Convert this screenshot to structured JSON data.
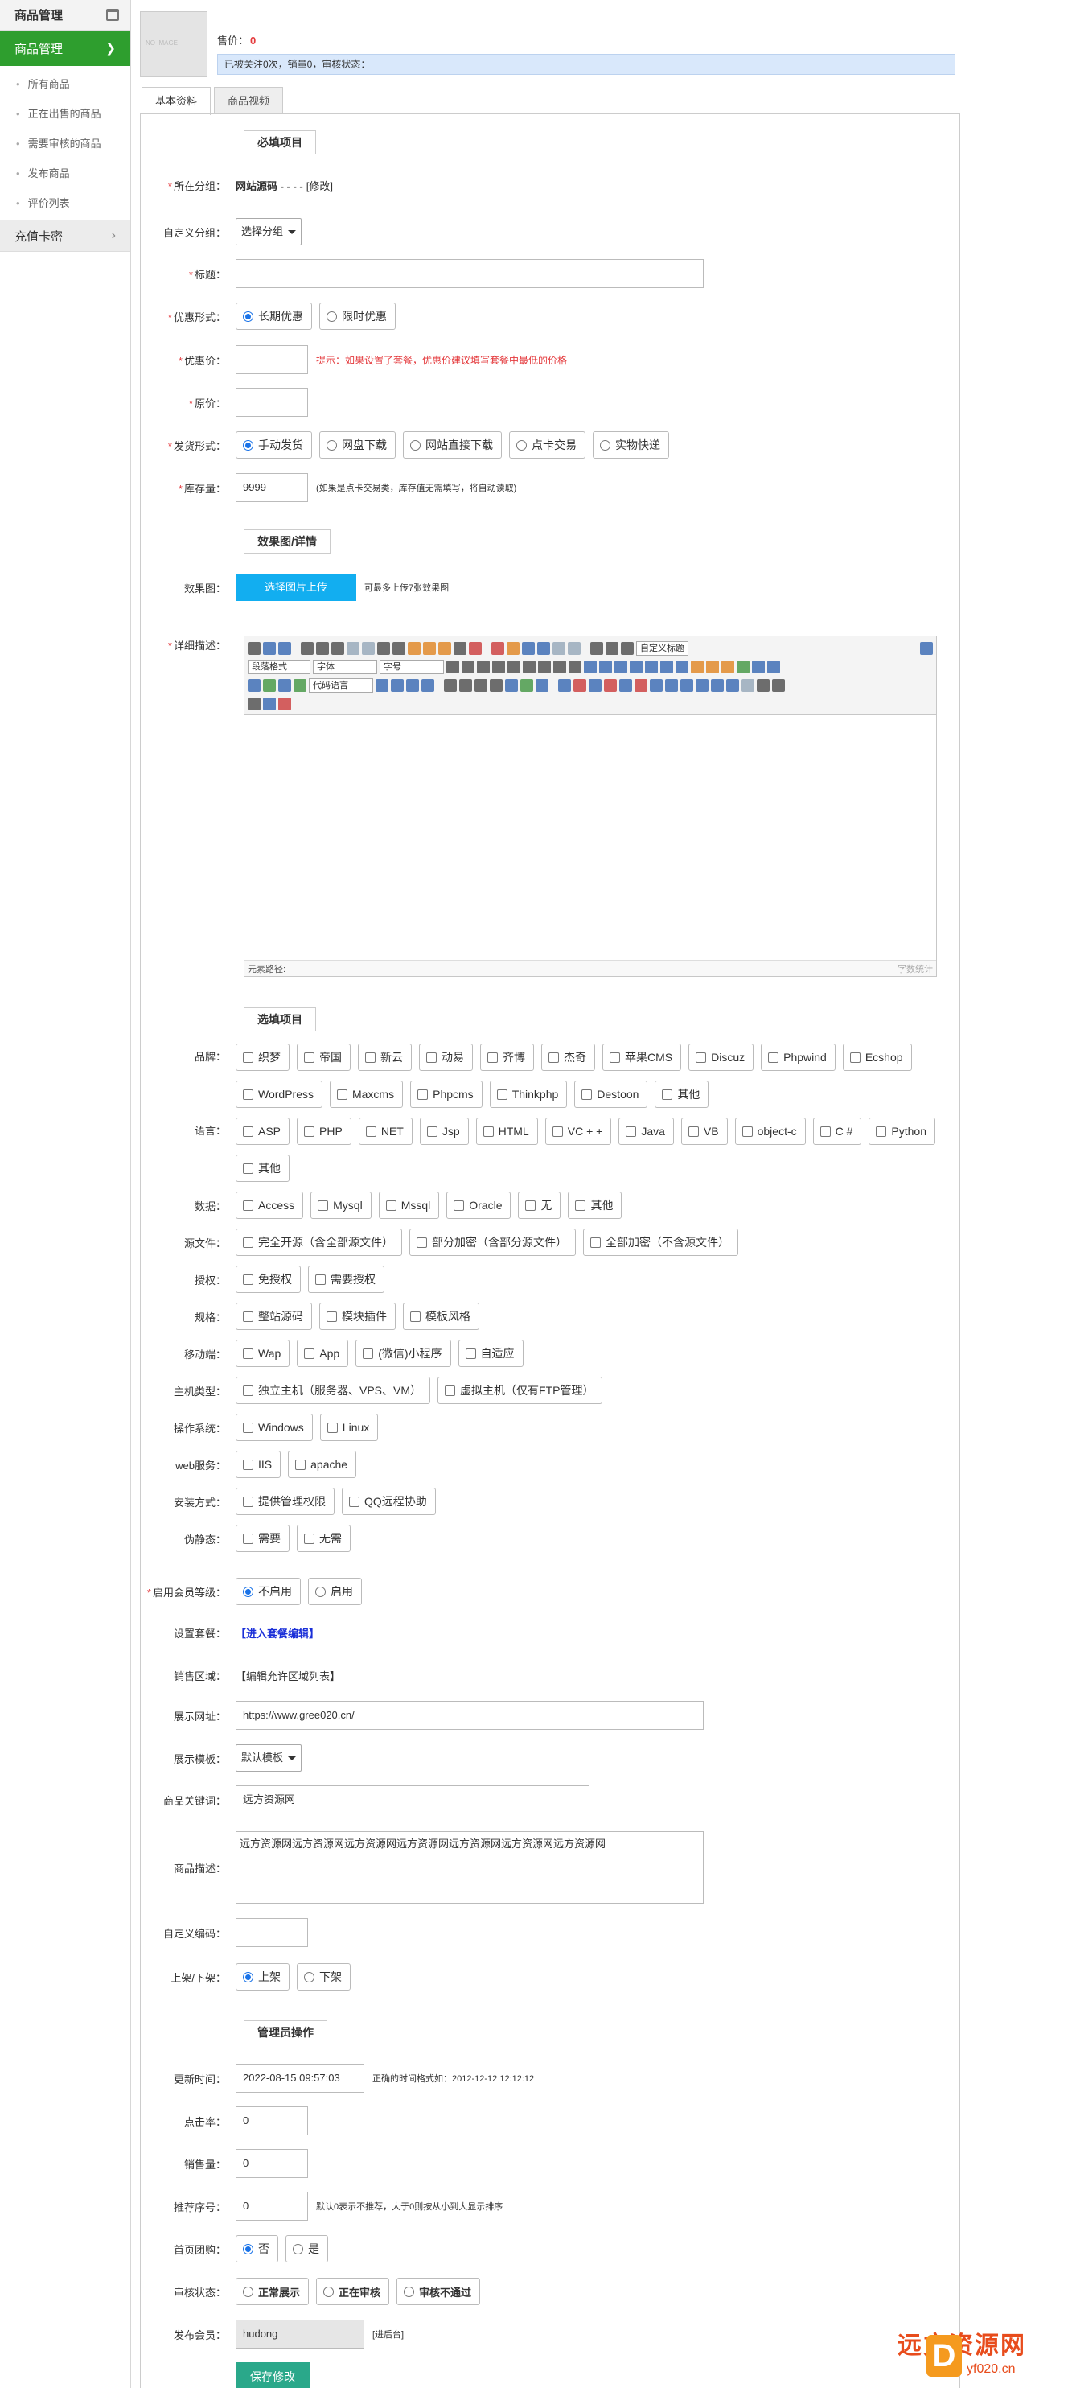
{
  "sidebar": {
    "title": "商品管理",
    "active": "商品管理",
    "items": [
      "所有商品",
      "正在出售的商品",
      "需要审核的商品",
      "发布商品",
      "评价列表"
    ],
    "group": "充值卡密"
  },
  "product": {
    "thumb_text": "NO IMAGE",
    "price_label": "售价：",
    "price_value": "0",
    "info": "已被关注0次，销量0，审核状态："
  },
  "tabs": [
    "基本资料",
    "商品视频"
  ],
  "sections": {
    "required": "必填项目",
    "images": "效果图/详情",
    "options": "选填项目",
    "admin": "管理员操作"
  },
  "form": {
    "category": {
      "label": "所在分组：",
      "value": "网站源码 - - - -",
      "edit": "[修改]"
    },
    "custom_group": {
      "label": "自定义分组：",
      "value": "选择分组"
    },
    "title": {
      "label": "标题：",
      "value": ""
    },
    "discount_type": {
      "label": "优惠形式：",
      "options": [
        "长期优惠",
        "限时优惠"
      ],
      "selected": 0
    },
    "discount_price": {
      "label": "优惠价：",
      "value": "",
      "hint": "提示：如果设置了套餐，优惠价建议填写套餐中最低的价格"
    },
    "original_price": {
      "label": "原价：",
      "value": ""
    },
    "delivery": {
      "label": "发货形式：",
      "options": [
        "手动发货",
        "网盘下载",
        "网站直接下载",
        "点卡交易",
        "实物快递"
      ],
      "selected": 0
    },
    "stock": {
      "label": "库存量：",
      "value": "9999",
      "hint": "(如果是点卡交易类，库存值无需填写，将自动读取)"
    },
    "effect_img": {
      "label": "效果图：",
      "button": "选择图片上传",
      "hint": "可最多上传7张效果图"
    },
    "detail": {
      "label": "详细描述：",
      "paragraph": "段落格式",
      "font": "字体",
      "size": "字号",
      "code": "代码语言",
      "custom_title": "自定义标题",
      "path": "元素路径:",
      "count": "字数统计"
    },
    "brand": {
      "label": "品牌：",
      "options": [
        "织梦",
        "帝国",
        "新云",
        "动易",
        "齐博",
        "杰奇",
        "苹果CMS",
        "Discuz",
        "Phpwind",
        "Ecshop",
        "WordPress",
        "Maxcms",
        "Phpcms",
        "Thinkphp",
        "Destoon",
        "其他"
      ]
    },
    "language": {
      "label": "语言：",
      "options": [
        "ASP",
        "PHP",
        "NET",
        "Jsp",
        "HTML",
        "VC + +",
        "Java",
        "VB",
        "object-c",
        "C #",
        "Python",
        "其他"
      ]
    },
    "database": {
      "label": "数据：",
      "options": [
        "Access",
        "Mysql",
        "Mssql",
        "Oracle",
        "无",
        "其他"
      ]
    },
    "source": {
      "label": "源文件：",
      "options": [
        "完全开源（含全部源文件）",
        "部分加密（含部分源文件）",
        "全部加密（不含源文件）"
      ]
    },
    "license": {
      "label": "授权：",
      "options": [
        "免授权",
        "需要授权"
      ]
    },
    "spec": {
      "label": "规格：",
      "options": [
        "整站源码",
        "模块插件",
        "模板风格"
      ]
    },
    "mobile": {
      "label": "移动端：",
      "options": [
        "Wap",
        "App",
        "(微信)小程序",
        "自适应"
      ]
    },
    "host": {
      "label": "主机类型：",
      "options": [
        "独立主机（服务器、VPS、VM）",
        "虚拟主机（仅有FTP管理）"
      ]
    },
    "os": {
      "label": "操作系统：",
      "options": [
        "Windows",
        "Linux"
      ]
    },
    "web": {
      "label": "web服务：",
      "options": [
        "IIS",
        "apache"
      ]
    },
    "install": {
      "label": "安装方式：",
      "options": [
        "提供管理权限",
        "QQ远程协助"
      ]
    },
    "rewrite": {
      "label": "伪静态：",
      "options": [
        "需要",
        "无需"
      ]
    },
    "member": {
      "label": "启用会员等级：",
      "options": [
        "不启用",
        "启用"
      ],
      "selected": 0
    },
    "package": {
      "label": "设置套餐：",
      "value": "【进入套餐编辑】"
    },
    "region": {
      "label": "销售区域：",
      "value": "【编辑允许区域列表】"
    },
    "demo_url": {
      "label": "展示网址：",
      "value": "https://www.gree020.cn/"
    },
    "template": {
      "label": "展示模板：",
      "value": "默认模板"
    },
    "keywords": {
      "label": "商品关键词：",
      "value": "远方资源网"
    },
    "description": {
      "label": "商品描述：",
      "value": "远方资源网远方资源网远方资源网远方资源网远方资源网远方资源网远方资源网"
    },
    "custom_code": {
      "label": "自定义编码：",
      "value": ""
    },
    "shelf": {
      "label": "上架/下架：",
      "options": [
        "上架",
        "下架"
      ],
      "selected": 0
    },
    "update_time": {
      "label": "更新时间：",
      "value": "2022-08-15 09:57:03",
      "hint": "正确的时间格式如：2012-12-12 12:12:12"
    },
    "clicks": {
      "label": "点击率：",
      "value": "0"
    },
    "sales": {
      "label": "销售量：",
      "value": "0"
    },
    "recommend": {
      "label": "推荐序号：",
      "value": "0",
      "hint": "默认0表示不推荐，大于0则按从小到大显示排序"
    },
    "home_group": {
      "label": "首页团购：",
      "options": [
        "否",
        "是"
      ],
      "selected": 0
    },
    "review": {
      "label": "审核状态：",
      "options": [
        "正常展示",
        "正在审核",
        "审核不通过"
      ]
    },
    "publisher": {
      "label": "发布会员：",
      "value": "hudong",
      "link": "[进后台]"
    },
    "save": "保存修改"
  },
  "watermark": {
    "title": "远方资源网",
    "d": "D",
    "url": "yf020.cn"
  }
}
